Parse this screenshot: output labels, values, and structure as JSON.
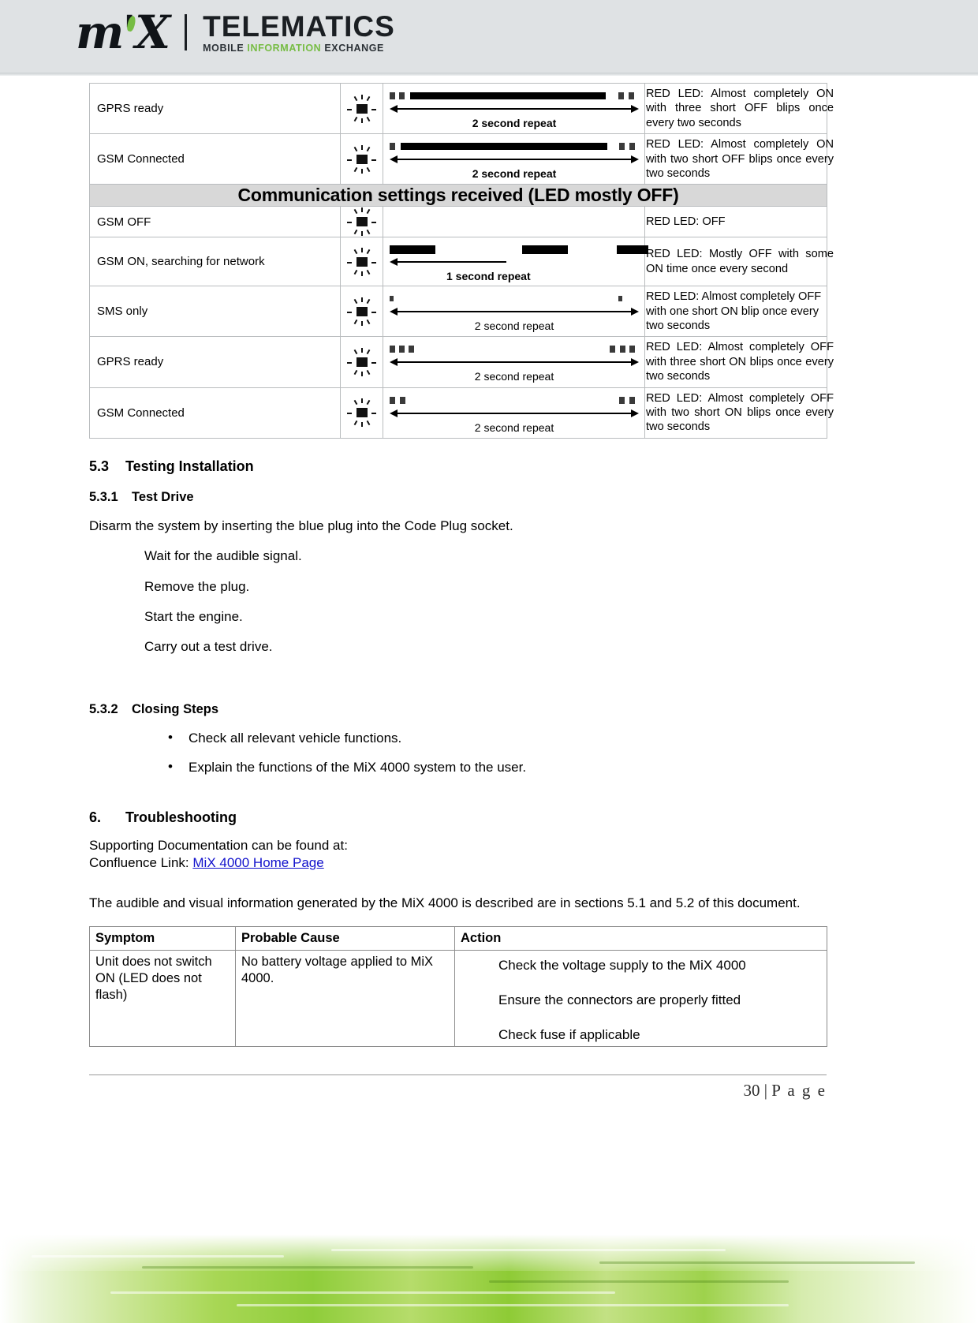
{
  "brand": {
    "mark": "m'X",
    "title": "TELEMATICS",
    "sub_mobile": "MOBILE ",
    "sub_information": "INFORMATION",
    "sub_exchange": " EXCHANGE",
    "accent_green": "#76bc43"
  },
  "led_table": {
    "rows_top": [
      {
        "name": "GPRS ready",
        "icon": "led-flashing-icon",
        "repeat_label": "2 second repeat",
        "description": "RED LED: Almost completely ON with three short OFF blips once every two seconds"
      },
      {
        "name": "GSM Connected",
        "icon": "led-flashing-icon",
        "repeat_label": "2 second repeat",
        "description": "RED LED: Almost completely ON with two short OFF blips once every two seconds"
      }
    ],
    "banner": "Communication settings received (LED mostly OFF)",
    "rows_bottom": [
      {
        "name": "GSM OFF",
        "icon": "led-flashing-icon",
        "repeat_label": "",
        "description": "RED LED: OFF"
      },
      {
        "name": "GSM ON, searching for network",
        "icon": "led-flashing-icon",
        "repeat_label": "1 second repeat",
        "description": "RED LED: Mostly OFF with some ON time once every second"
      },
      {
        "name": "SMS only",
        "icon": "led-flashing-icon",
        "repeat_label": "2 second repeat",
        "description": "RED LED: Almost completely OFF with one short ON blip once every two seconds"
      },
      {
        "name": "GPRS ready",
        "icon": "led-flashing-icon",
        "repeat_label": "2 second repeat",
        "description": "RED LED: Almost completely OFF with three short ON blips once every two seconds"
      },
      {
        "name": "GSM  Connected",
        "icon": "led-flashing-icon",
        "repeat_label": "2 second repeat",
        "description": "RED LED: Almost completely OFF with two short ON blips once every two seconds"
      }
    ]
  },
  "sections": {
    "s53_num": "5.3",
    "s53_title": "Testing Installation",
    "s531_num": "5.3.1",
    "s531_title": "Test Drive",
    "s531_intro": "Disarm the system by inserting the blue plug into the Code Plug socket.",
    "s531_steps": [
      "Wait for the audible signal.",
      "Remove the plug.",
      "Start the engine.",
      "Carry out a test drive."
    ],
    "s532_num": "5.3.2",
    "s532_title": "Closing Steps",
    "s532_bullets": [
      "Check all relevant vehicle functions.",
      "Explain the functions of the MiX 4000 system to the user."
    ],
    "s6_num": "6.",
    "s6_title": "Troubleshooting",
    "s6_line1": "Supporting Documentation can be found at:",
    "s6_line2_prefix": "Confluence Link: ",
    "s6_link_text": "MiX 4000 Home Page",
    "s6_para": "The audible and visual information generated by the MiX 4000 is described are in sections 5.1 and 5.2 of this document."
  },
  "trouble_table": {
    "headers": [
      "Symptom",
      "Probable Cause",
      "Action"
    ],
    "rows": [
      {
        "symptom": "Unit does not switch ON (LED does not flash)",
        "cause": "No battery voltage applied to MiX 4000.",
        "actions": [
          "Check the voltage supply to the MiX 4000",
          "Ensure the connectors are properly fitted",
          "Check fuse if applicable"
        ]
      }
    ]
  },
  "footer": {
    "page_number": "30",
    "separator": " | ",
    "page_word": "P a g e"
  }
}
